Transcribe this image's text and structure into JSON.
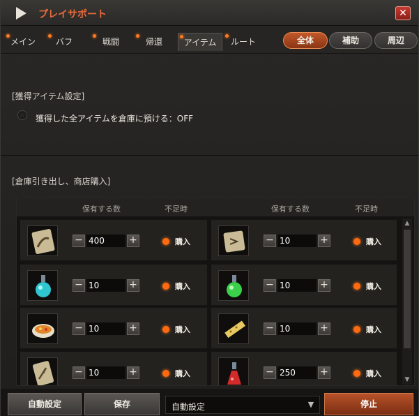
{
  "window": {
    "title": "プレイサポート",
    "close_glyph": "✕"
  },
  "tabs": [
    {
      "label": "メイン"
    },
    {
      "label": "バフ"
    },
    {
      "label": "戦闘"
    },
    {
      "label": "帰還"
    },
    {
      "label": "アイテム"
    },
    {
      "label": "ルート"
    }
  ],
  "filters": [
    {
      "label": "全体",
      "active": true
    },
    {
      "label": "補助",
      "active": false
    },
    {
      "label": "周辺",
      "active": false
    }
  ],
  "acquire_section": {
    "title": "[獲得アイテム設定]",
    "option_label": "獲得した全アイテムを倉庫に預ける：OFF"
  },
  "warehouse_section": {
    "title": "[倉庫引き出し、商店購入]",
    "headers": {
      "qty": "保有する数",
      "shortage": "不足時"
    },
    "items": [
      {
        "icon": "return-scroll-icon",
        "value": "400",
        "buy_label": "購入"
      },
      {
        "icon": "teleport-scroll-icon",
        "value": "10",
        "buy_label": "購入"
      },
      {
        "icon": "blue-potion-icon",
        "value": "10",
        "buy_label": "購入"
      },
      {
        "icon": "green-potion-icon",
        "value": "10",
        "buy_label": "購入"
      },
      {
        "icon": "food-bowl-icon",
        "value": "10",
        "buy_label": "購入"
      },
      {
        "icon": "gold-bar-icon",
        "value": "10",
        "buy_label": "購入"
      },
      {
        "icon": "enchant-scroll-icon",
        "value": "10",
        "buy_label": "購入"
      },
      {
        "icon": "red-potion-icon",
        "value": "250",
        "buy_label": "購入"
      }
    ]
  },
  "footer": {
    "auto_settings_label": "自動設定",
    "save_label": "保存",
    "select_value": "自動設定",
    "stop_label": "停止"
  }
}
